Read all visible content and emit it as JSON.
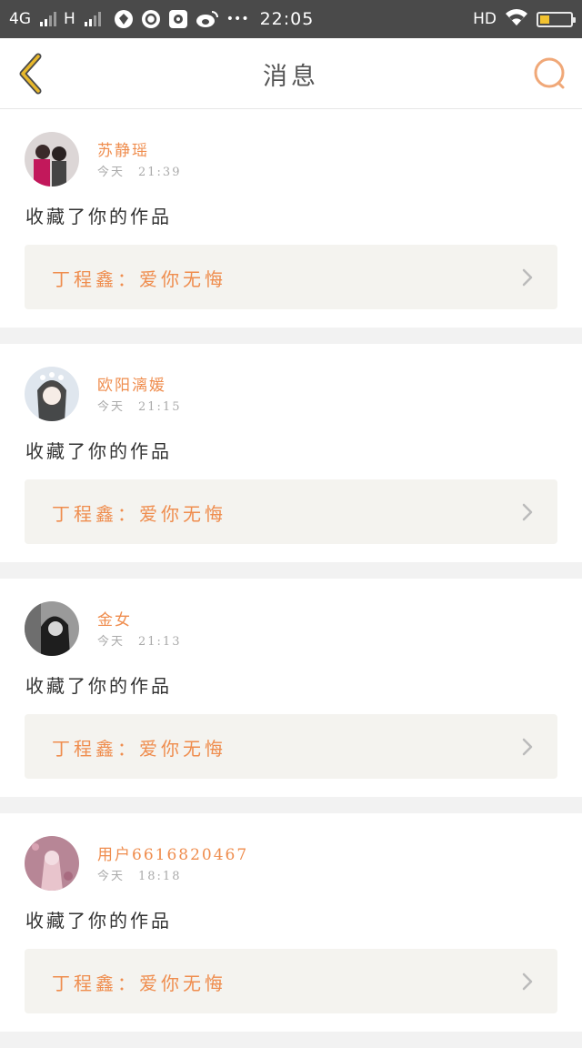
{
  "status_bar": {
    "net_4g": "4G",
    "net_h": "H",
    "more": "•••",
    "time": "22:05",
    "hd": "HD",
    "icons": [
      "shield-app-icon",
      "camera-app-icon",
      "sim-app-icon",
      "weibo-icon",
      "wifi-icon",
      "battery-icon"
    ]
  },
  "header": {
    "title": "消息",
    "back_icon": "chevron-left-icon",
    "search_icon": "search-icon"
  },
  "colors": {
    "accent": "#ef8d4e",
    "back_icon": "#e8b82b",
    "status_bar": "#4a4a4a",
    "card_link_bg": "#f4f3ef"
  },
  "messages": [
    {
      "username": "苏静瑶",
      "time": "今天　21:39",
      "action": "收藏了你的作品",
      "work": "丁程鑫：爱你无悔"
    },
    {
      "username": "欧阳漓媛",
      "time": "今天　21:15",
      "action": "收藏了你的作品",
      "work": "丁程鑫：爱你无悔"
    },
    {
      "username": "金女",
      "time": "今天　21:13",
      "action": "收藏了你的作品",
      "work": "丁程鑫：爱你无悔"
    },
    {
      "username": "用户6616820467",
      "time": "今天　18:18",
      "action": "收藏了你的作品",
      "work": "丁程鑫：爱你无悔"
    }
  ]
}
